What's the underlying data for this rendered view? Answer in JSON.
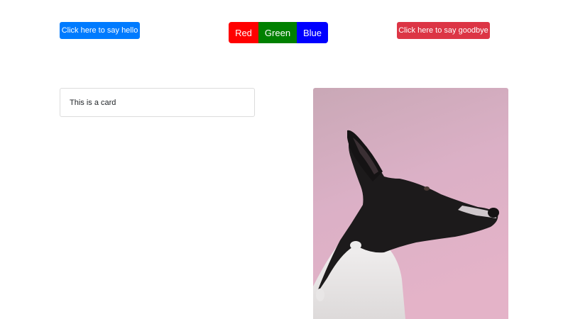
{
  "buttons": {
    "hello": {
      "label": "Click here to say hello",
      "color": "#007bff"
    },
    "goodbye": {
      "label": "Click here to say goodbye",
      "color": "#dc3545"
    }
  },
  "color_group": {
    "items": [
      {
        "label": "Red",
        "color": "#ff0000"
      },
      {
        "label": "Green",
        "color": "#008000"
      },
      {
        "label": "Blue",
        "color": "#0000ff"
      }
    ]
  },
  "card": {
    "text": "This is a card"
  },
  "image": {
    "subject": "dog-photo",
    "background": "#dbaec4"
  }
}
